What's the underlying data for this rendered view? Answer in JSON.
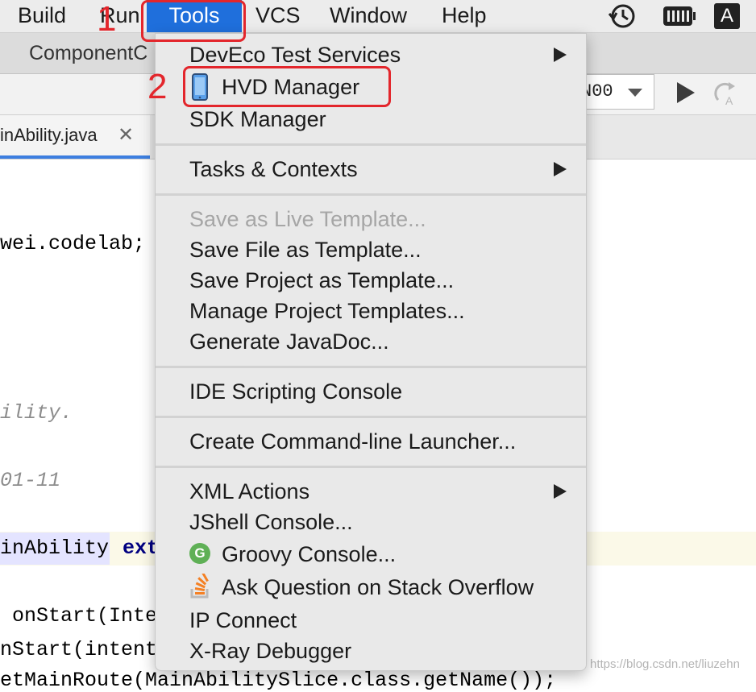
{
  "menubar": {
    "items": [
      {
        "label": "Build"
      },
      {
        "label": "Run"
      },
      {
        "label": "Tools"
      },
      {
        "label": "VCS"
      },
      {
        "label": "Window"
      },
      {
        "label": "Help"
      }
    ],
    "input_indicator": "A"
  },
  "tabbar": {
    "label": "ComponentC"
  },
  "toolbar": {
    "device_label": "N00"
  },
  "file_tab": {
    "label": "inAbility.java",
    "close": "✕"
  },
  "editor": {
    "lines": [
      "wei.codelab;",
      "ility.",
      "01-11",
      "inAbility",
      "ext",
      " onStart(Inte",
      "nStart(intent",
      "etMainRoute(MainAbilitySlice.class.getName());"
    ]
  },
  "dropdown": {
    "items": [
      {
        "label": "DevEco Test Services",
        "submenu": true
      },
      {
        "label": "HVD Manager",
        "icon": "phone-icon"
      },
      {
        "label": "SDK Manager"
      },
      {
        "label": "Tasks & Contexts",
        "submenu": true
      },
      {
        "label": "Save as Live Template...",
        "disabled": true
      },
      {
        "label": "Save File as Template..."
      },
      {
        "label": "Save Project as Template..."
      },
      {
        "label": "Manage Project Templates..."
      },
      {
        "label": "Generate JavaDoc..."
      },
      {
        "label": "IDE Scripting Console"
      },
      {
        "label": "Create Command-line Launcher..."
      },
      {
        "label": "XML Actions",
        "submenu": true
      },
      {
        "label": "JShell Console..."
      },
      {
        "label": "Groovy Console...",
        "icon": "groovy-icon"
      },
      {
        "label": "Ask Question on Stack Overflow",
        "icon": "stackoverflow-icon"
      },
      {
        "label": "IP Connect"
      },
      {
        "label": "X-Ray Debugger"
      }
    ],
    "groovy_icon_letter": "G"
  },
  "annotations": {
    "step1": "1",
    "step2": "2"
  },
  "watermark": "https://blog.csdn.net/liuzehn",
  "colors": {
    "menu_active": "#1f6fdc",
    "annotation": "#e3262c",
    "groovy": "#5fb056",
    "stackoverflow": "#f48024"
  }
}
